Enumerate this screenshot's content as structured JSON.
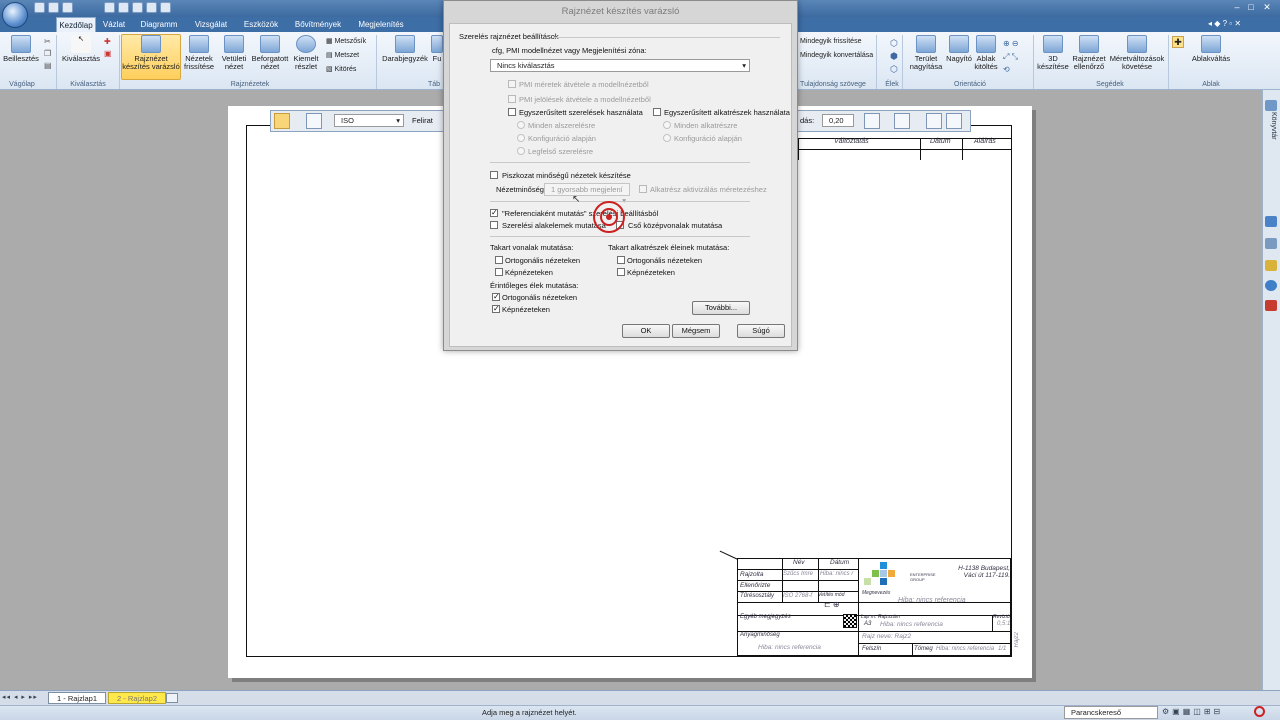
{
  "tabs": [
    "Kezdőlap",
    "Vázlat",
    "Diagramm",
    "Vizsgálat",
    "Eszközök",
    "Bővítmények",
    "Megjelenítés"
  ],
  "ribbon": {
    "beillesztes": "Beillesztés",
    "kivalasztas": "Kiválasztás",
    "rajznezet_varazslo": "Rajznézet készítés varázsló",
    "nezetek_frissitese": "Nézetek frissítése",
    "vetuleti_nezet": "Vetületi nézet",
    "beforgatott_nezet": "Beforgatott nézet",
    "kiemelt_reszlet": "Kiemelt részlet",
    "metszosik": "Metszősík",
    "metszet": "Metszet",
    "kitores": "Kitörés",
    "darabjegyzek": "Darabjegyzék",
    "fu": "Fu",
    "mindegyik_frissitese": "Mindegyik frissítése",
    "mindegyik_konvertalasa": "Mindegyik konvertálása",
    "terulet_nagyitasa": "Terület nagyítása",
    "nagyito": "Nagyító",
    "ablak_kitoltes": "Ablak kitöltés",
    "keszitese_3d": "3D készítése",
    "rajznezet_ellenorzo": "Rajznézet ellenőrző",
    "meretvaltozasok": "Méretváltozások követése",
    "ablakvaltas": "Ablakváltás",
    "groups": {
      "vagolap": "Vágólap",
      "kivalasztas": "Kiválasztás",
      "rajznezetek": "Rajznézetek",
      "tab": "Táb",
      "tulajdonsag": "Tulajdonság szövege",
      "elek": "Élek",
      "orientacio": "Orientáció",
      "segedek": "Segédek",
      "ablak": "Ablak"
    }
  },
  "right_strip_label": "Könyvtár",
  "drawing_toolbar": {
    "standard": "ISO",
    "felirat": "Felirat",
    "scale_label": "dás:",
    "scale_value": "0,20"
  },
  "revision": {
    "col1": "Változtatás",
    "col2": "Dátum",
    "col3": "Aláírás"
  },
  "title_block": {
    "nev": "Név",
    "datum": "Dátum",
    "rajzolta": "Rajzolta",
    "rajzolta_name": "Szűcs Imre",
    "datum_value": "Hiba: nincs r",
    "ellenorizte": "Ellenőrizte",
    "turesosztaly": "Tűrésosztály",
    "turesosztaly_value": "ISO 2768-f",
    "vetites": "Vetítés mód",
    "company": "H-1138 Budapest, Váci út 117-119.",
    "logo_text": "ENTERPRISE GROUP",
    "megnevezes": "Megnevezés",
    "hiba_ref": "Hiba: nincs referencia",
    "egyeb": "Egyéb megjegyzés",
    "anyagminoseg": "Anyagminőség",
    "lapm": "Lap m.",
    "lap_value": "A3",
    "rajzszam": "Rajzszám",
    "rajzszam_value": "Hiba: nincs referencia",
    "revizio": "Revízió",
    "meretarany": "0,5:1",
    "rajzneve": "Rajz neve: Rajz2",
    "felszin": "Felszín",
    "tomeg": "Tömeg",
    "tomeg_value": "Hiba: nincs referencia",
    "lap_num": "1/1",
    "rajz2": "Rajz2"
  },
  "dialog": {
    "title": "Rajznézet készítés varázsló",
    "section": "Szerelés rajznézet beállítások",
    "cfg_label": "cfg, PMI modellnézet vagy Megjelenítési zóna:",
    "cfg_value": "Nincs kiválasztás",
    "pmi_meretek": "PMI méretek átvétele a modellnézetből",
    "pmi_jelolesek": "PMI jelölések átvétele a modellnézetből",
    "egysz_szerelesek": "Egyszerűsített szerelések használata",
    "egysz_alkatreszek": "Egyszerűsített alkatrészek használata",
    "minden_alszerelesre": "Minden alszerelésre",
    "konfiguracio_alapjan": "Konfiguráció alapján",
    "legfelso": "Legfelső szerelésre",
    "minden_alkatreszre": "Minden alkatrészre",
    "konfiguracio_alapjan2": "Konfiguráció alapján",
    "piszkozat": "Piszkozat minőségű nézetek készítése",
    "nezetminoseg_label": "Nézetminőség:",
    "nezetminoseg_value": "1 gyorsabb megjelení",
    "alkatresz_aktivizalas": "Alkatrész aktivizálás méretezéshez",
    "referenciakent": "\"Referenciaként mutatás\" szerelési beállításból",
    "szerelesi_alakelemek": "Szerelési alakelemek mutatása",
    "cso_kozepvonalak": "Cső középvonalak mutatása",
    "takart_vonalak": "Takart vonalak mutatása:",
    "takart_alkatreszek": "Takart alkatrészek éleinek mutatása:",
    "ortogonalis": "Ortogonális nézeteken",
    "kepnezeteken": "Képnézeteken",
    "ortogonalis2": "Ortogonális nézeteken",
    "kepnezeteken2": "Képnézeteken",
    "erintoleges": "Érintőleges élek mutatása:",
    "ortogonalis3": "Ortogonális nézeteken",
    "kepnezeteken3": "Képnézeteken",
    "tovabbi": "További...",
    "ok": "OK",
    "megsem": "Mégsem",
    "sugo": "Súgó"
  },
  "sheet_tabs": [
    "1 - Rajzlap1",
    "2 - Rajzlap2"
  ],
  "status": {
    "message": "Adja meg a rajznézet helyét.",
    "search": "Parancskereső"
  },
  "colors": {
    "accent": "#3e6ea6",
    "highlight": "#ffcf5c",
    "target": "#cc1f1f",
    "active_tab": "#ffe94a"
  }
}
